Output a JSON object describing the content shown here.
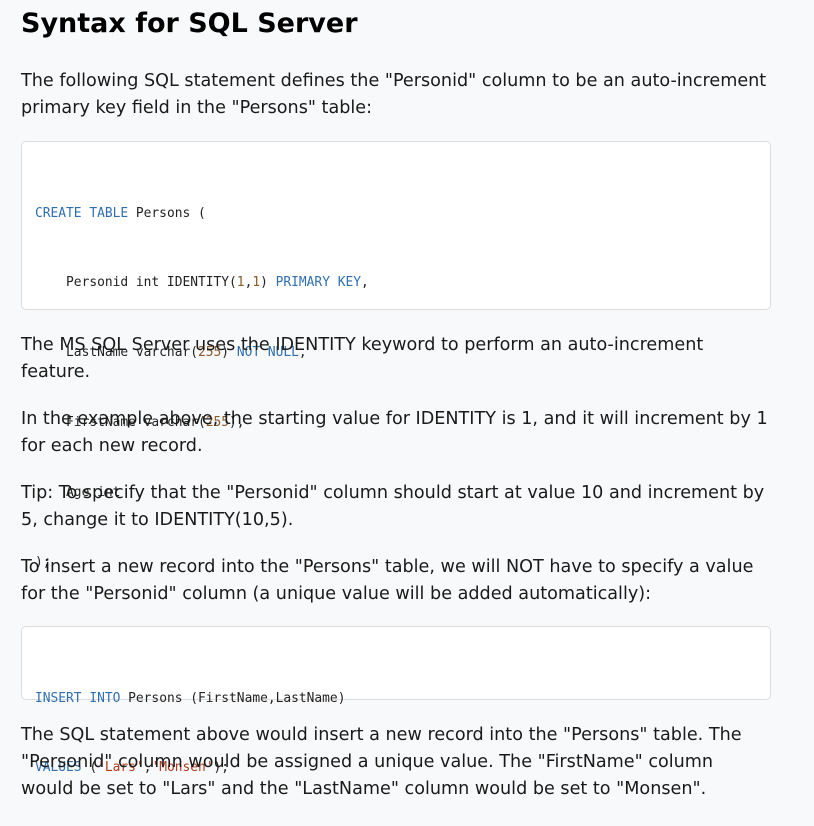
{
  "heading": "Syntax for SQL Server",
  "intro": {
    "line1": "The following SQL statement defines the \"Personid\" column to be an auto-increment",
    "line2": "primary key field in the \"Persons\" table:"
  },
  "create_code": {
    "l1": {
      "kw1": "CREATE TABLE",
      "rest": " Persons ("
    },
    "l2": {
      "pre": "    Personid int IDENTITY(",
      "n1": "1",
      "comma": ",",
      "n2": "1",
      "close": ") ",
      "kw": "PRIMARY KEY",
      "end": ","
    },
    "l3": {
      "pre": "    LastName varchar(",
      "n": "255",
      "close": ") ",
      "kw": "NOT NULL",
      "end": ","
    },
    "l4": {
      "pre": "    FirstName varchar(",
      "n": "255",
      "end": "),"
    },
    "l5": {
      "text": "    Age int"
    },
    "l6": {
      "text": ");"
    }
  },
  "p_identity": {
    "line1": "The MS SQL Server uses the IDENTITY keyword to perform an auto-increment",
    "line2": "feature."
  },
  "p_example": {
    "line1": "In the example above, the starting value for IDENTITY is 1, and it will increment by 1",
    "line2": "for each new record."
  },
  "p_tip": {
    "line1": "Tip: To specify that the \"Personid\" column should start at value 10 and increment by",
    "line2": "5, change it to IDENTITY(10,5)."
  },
  "p_insert": {
    "line1": "To insert a new record into the \"Persons\" table, we will NOT have to specify a value",
    "line2": "for the \"Personid\" column (a unique value will be added automatically):"
  },
  "insert_code": {
    "l1": {
      "kw1": "INSERT",
      "sp": " ",
      "kw2": "INTO",
      "rest": " Persons (FirstName,LastName)"
    },
    "l2": {
      "kw": "VALUES",
      "open": " (",
      "s1": "'Lars'",
      "comma": ",",
      "s2": "'Monsen'",
      "end": ");"
    }
  },
  "p_result": {
    "line1": "The SQL statement above would insert a new record into the \"Persons\" table. The",
    "line2": "\"Personid\" column would be assigned a unique value. The \"FirstName\" column",
    "line3": "would be set to \"Lars\" and the \"LastName\" column would be set to \"Monsen\"."
  }
}
